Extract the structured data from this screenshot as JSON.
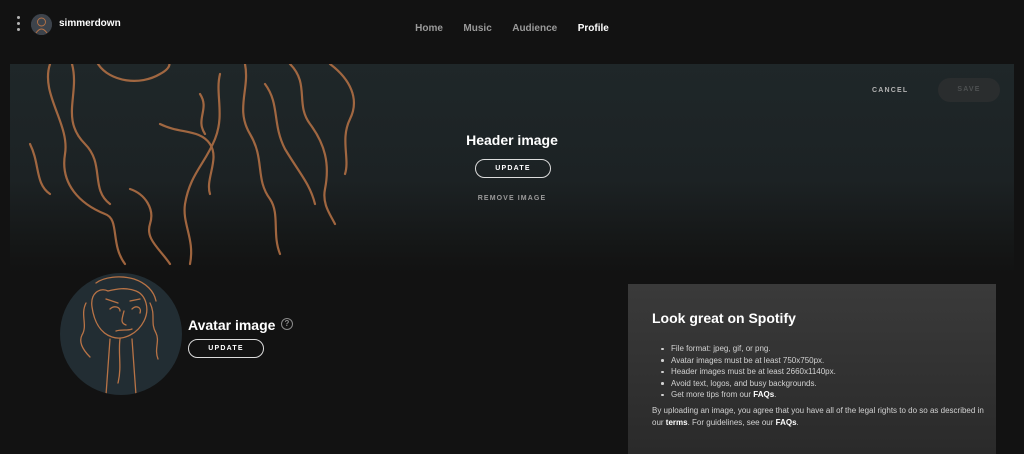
{
  "topbar": {
    "username": "simmerdown",
    "nav": [
      {
        "label": "Home",
        "active": false
      },
      {
        "label": "Music",
        "active": false
      },
      {
        "label": "Audience",
        "active": false
      },
      {
        "label": "Profile",
        "active": true
      }
    ]
  },
  "header": {
    "title": "Header image",
    "update_label": "UPDATE",
    "remove_label": "REMOVE IMAGE",
    "cancel_label": "CANCEL",
    "save_label": "SAVE"
  },
  "avatar": {
    "title": "Avatar image",
    "help_symbol": "?",
    "update_label": "UPDATE"
  },
  "tips": {
    "title": "Look great on Spotify",
    "items": [
      "File format: jpeg, gif, or png.",
      "Avatar images must be at least 750x750px.",
      "Header images must be at least 2660x1140px.",
      "Avoid text, logos, and busy backgrounds."
    ],
    "faq_prefix": "Get more tips from our ",
    "faq_link": "FAQs",
    "faq_suffix": ".",
    "terms_prefix": "By uploading an image, you agree that you have all of the legal rights to do so as described in our ",
    "terms_link": "terms",
    "terms_middle": ". For guidelines, see our ",
    "terms_faq_link": "FAQs",
    "terms_suffix": "."
  },
  "colors": {
    "background": "#121212",
    "line_art": "#b87346",
    "accent_text": "#ffffff"
  },
  "icons": [
    "more-vertical-icon",
    "help-icon"
  ]
}
